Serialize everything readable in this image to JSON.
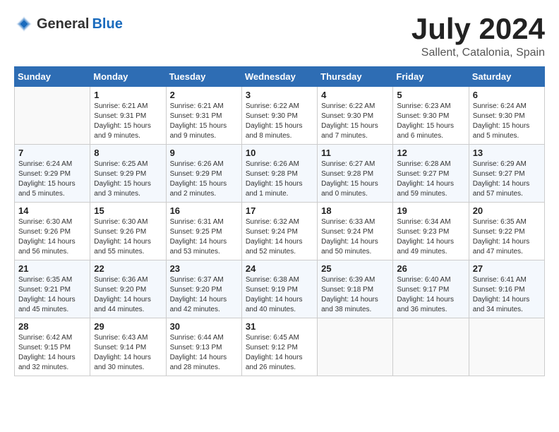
{
  "header": {
    "logo_general": "General",
    "logo_blue": "Blue",
    "month_year": "July 2024",
    "location": "Sallent, Catalonia, Spain"
  },
  "weekdays": [
    "Sunday",
    "Monday",
    "Tuesday",
    "Wednesday",
    "Thursday",
    "Friday",
    "Saturday"
  ],
  "weeks": [
    [
      {
        "day": "",
        "sunrise": "",
        "sunset": "",
        "daylight": "",
        "empty": true
      },
      {
        "day": "1",
        "sunrise": "Sunrise: 6:21 AM",
        "sunset": "Sunset: 9:31 PM",
        "daylight": "Daylight: 15 hours and 9 minutes."
      },
      {
        "day": "2",
        "sunrise": "Sunrise: 6:21 AM",
        "sunset": "Sunset: 9:31 PM",
        "daylight": "Daylight: 15 hours and 9 minutes."
      },
      {
        "day": "3",
        "sunrise": "Sunrise: 6:22 AM",
        "sunset": "Sunset: 9:30 PM",
        "daylight": "Daylight: 15 hours and 8 minutes."
      },
      {
        "day": "4",
        "sunrise": "Sunrise: 6:22 AM",
        "sunset": "Sunset: 9:30 PM",
        "daylight": "Daylight: 15 hours and 7 minutes."
      },
      {
        "day": "5",
        "sunrise": "Sunrise: 6:23 AM",
        "sunset": "Sunset: 9:30 PM",
        "daylight": "Daylight: 15 hours and 6 minutes."
      },
      {
        "day": "6",
        "sunrise": "Sunrise: 6:24 AM",
        "sunset": "Sunset: 9:30 PM",
        "daylight": "Daylight: 15 hours and 5 minutes."
      }
    ],
    [
      {
        "day": "7",
        "sunrise": "Sunrise: 6:24 AM",
        "sunset": "Sunset: 9:29 PM",
        "daylight": "Daylight: 15 hours and 5 minutes."
      },
      {
        "day": "8",
        "sunrise": "Sunrise: 6:25 AM",
        "sunset": "Sunset: 9:29 PM",
        "daylight": "Daylight: 15 hours and 3 minutes."
      },
      {
        "day": "9",
        "sunrise": "Sunrise: 6:26 AM",
        "sunset": "Sunset: 9:29 PM",
        "daylight": "Daylight: 15 hours and 2 minutes."
      },
      {
        "day": "10",
        "sunrise": "Sunrise: 6:26 AM",
        "sunset": "Sunset: 9:28 PM",
        "daylight": "Daylight: 15 hours and 1 minute."
      },
      {
        "day": "11",
        "sunrise": "Sunrise: 6:27 AM",
        "sunset": "Sunset: 9:28 PM",
        "daylight": "Daylight: 15 hours and 0 minutes."
      },
      {
        "day": "12",
        "sunrise": "Sunrise: 6:28 AM",
        "sunset": "Sunset: 9:27 PM",
        "daylight": "Daylight: 14 hours and 59 minutes."
      },
      {
        "day": "13",
        "sunrise": "Sunrise: 6:29 AM",
        "sunset": "Sunset: 9:27 PM",
        "daylight": "Daylight: 14 hours and 57 minutes."
      }
    ],
    [
      {
        "day": "14",
        "sunrise": "Sunrise: 6:30 AM",
        "sunset": "Sunset: 9:26 PM",
        "daylight": "Daylight: 14 hours and 56 minutes."
      },
      {
        "day": "15",
        "sunrise": "Sunrise: 6:30 AM",
        "sunset": "Sunset: 9:26 PM",
        "daylight": "Daylight: 14 hours and 55 minutes."
      },
      {
        "day": "16",
        "sunrise": "Sunrise: 6:31 AM",
        "sunset": "Sunset: 9:25 PM",
        "daylight": "Daylight: 14 hours and 53 minutes."
      },
      {
        "day": "17",
        "sunrise": "Sunrise: 6:32 AM",
        "sunset": "Sunset: 9:24 PM",
        "daylight": "Daylight: 14 hours and 52 minutes."
      },
      {
        "day": "18",
        "sunrise": "Sunrise: 6:33 AM",
        "sunset": "Sunset: 9:24 PM",
        "daylight": "Daylight: 14 hours and 50 minutes."
      },
      {
        "day": "19",
        "sunrise": "Sunrise: 6:34 AM",
        "sunset": "Sunset: 9:23 PM",
        "daylight": "Daylight: 14 hours and 49 minutes."
      },
      {
        "day": "20",
        "sunrise": "Sunrise: 6:35 AM",
        "sunset": "Sunset: 9:22 PM",
        "daylight": "Daylight: 14 hours and 47 minutes."
      }
    ],
    [
      {
        "day": "21",
        "sunrise": "Sunrise: 6:35 AM",
        "sunset": "Sunset: 9:21 PM",
        "daylight": "Daylight: 14 hours and 45 minutes."
      },
      {
        "day": "22",
        "sunrise": "Sunrise: 6:36 AM",
        "sunset": "Sunset: 9:20 PM",
        "daylight": "Daylight: 14 hours and 44 minutes."
      },
      {
        "day": "23",
        "sunrise": "Sunrise: 6:37 AM",
        "sunset": "Sunset: 9:20 PM",
        "daylight": "Daylight: 14 hours and 42 minutes."
      },
      {
        "day": "24",
        "sunrise": "Sunrise: 6:38 AM",
        "sunset": "Sunset: 9:19 PM",
        "daylight": "Daylight: 14 hours and 40 minutes."
      },
      {
        "day": "25",
        "sunrise": "Sunrise: 6:39 AM",
        "sunset": "Sunset: 9:18 PM",
        "daylight": "Daylight: 14 hours and 38 minutes."
      },
      {
        "day": "26",
        "sunrise": "Sunrise: 6:40 AM",
        "sunset": "Sunset: 9:17 PM",
        "daylight": "Daylight: 14 hours and 36 minutes."
      },
      {
        "day": "27",
        "sunrise": "Sunrise: 6:41 AM",
        "sunset": "Sunset: 9:16 PM",
        "daylight": "Daylight: 14 hours and 34 minutes."
      }
    ],
    [
      {
        "day": "28",
        "sunrise": "Sunrise: 6:42 AM",
        "sunset": "Sunset: 9:15 PM",
        "daylight": "Daylight: 14 hours and 32 minutes."
      },
      {
        "day": "29",
        "sunrise": "Sunrise: 6:43 AM",
        "sunset": "Sunset: 9:14 PM",
        "daylight": "Daylight: 14 hours and 30 minutes."
      },
      {
        "day": "30",
        "sunrise": "Sunrise: 6:44 AM",
        "sunset": "Sunset: 9:13 PM",
        "daylight": "Daylight: 14 hours and 28 minutes."
      },
      {
        "day": "31",
        "sunrise": "Sunrise: 6:45 AM",
        "sunset": "Sunset: 9:12 PM",
        "daylight": "Daylight: 14 hours and 26 minutes."
      },
      {
        "day": "",
        "sunrise": "",
        "sunset": "",
        "daylight": "",
        "empty": true
      },
      {
        "day": "",
        "sunrise": "",
        "sunset": "",
        "daylight": "",
        "empty": true
      },
      {
        "day": "",
        "sunrise": "",
        "sunset": "",
        "daylight": "",
        "empty": true
      }
    ]
  ]
}
